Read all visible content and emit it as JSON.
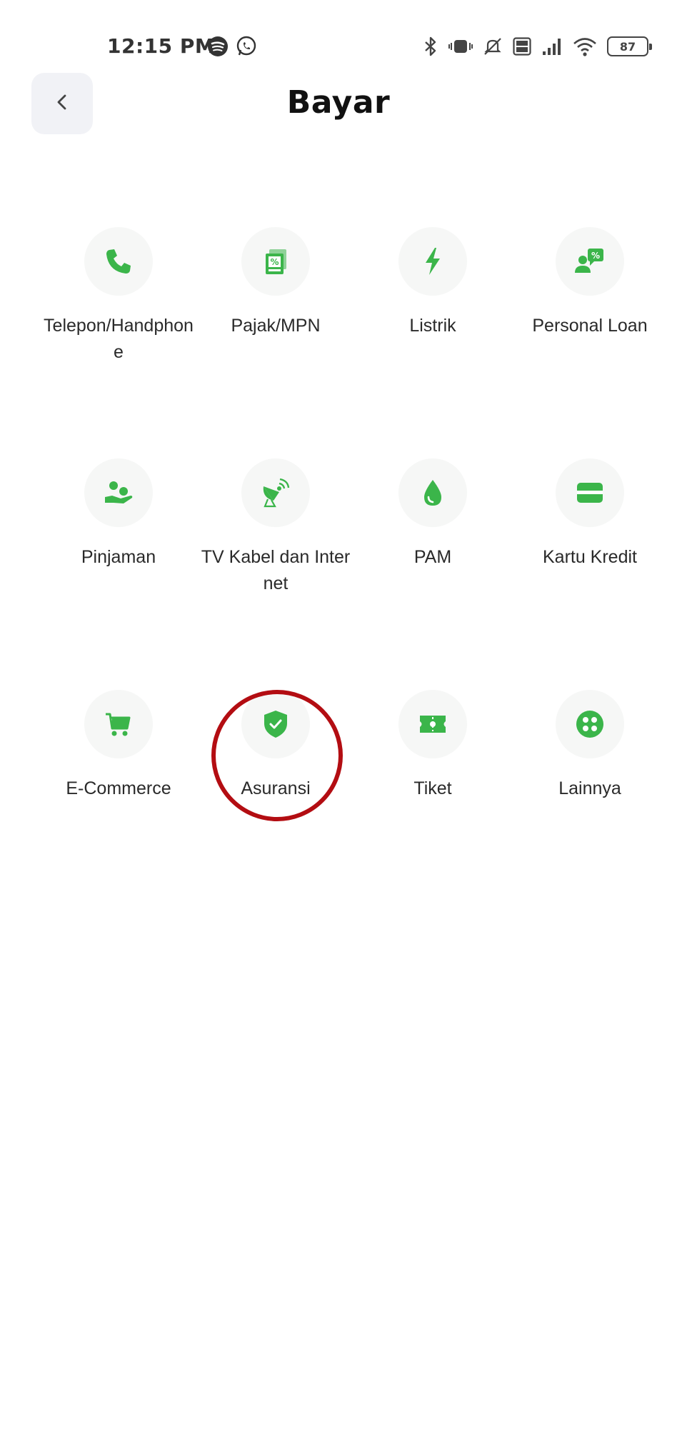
{
  "status_bar": {
    "time": "12:15 PM",
    "battery_level": "87",
    "left_icons": [
      "spotify-icon",
      "whatsapp-icon"
    ],
    "right_icons": [
      "bluetooth-icon",
      "vibrate-icon",
      "mute-icon",
      "volte-icon",
      "signal-icon",
      "wifi-icon",
      "battery-icon"
    ]
  },
  "header": {
    "title": "Bayar",
    "back_icon": "chevron-left-icon"
  },
  "colors": {
    "accent_green": "#3bb54a",
    "highlight_red": "#b30d12",
    "icon_bg": "#f6f7f6"
  },
  "menu": {
    "items": [
      {
        "label": "Telepon/Handphone",
        "icon": "phone-icon"
      },
      {
        "label": "Pajak/MPN",
        "icon": "tax-document-icon"
      },
      {
        "label": "Listrik",
        "icon": "lightning-icon"
      },
      {
        "label": "Personal Loan",
        "icon": "personal-loan-icon"
      },
      {
        "label": "Pinjaman",
        "icon": "loan-hand-icon"
      },
      {
        "label": "TV Kabel dan Internet",
        "icon": "satellite-dish-icon"
      },
      {
        "label": "PAM",
        "icon": "water-drop-icon"
      },
      {
        "label": "Kartu Kredit",
        "icon": "credit-card-icon"
      },
      {
        "label": "E-Commerce",
        "icon": "shopping-cart-icon"
      },
      {
        "label": "Asuransi",
        "icon": "shield-check-icon"
      },
      {
        "label": "Tiket",
        "icon": "ticket-icon"
      },
      {
        "label": "Lainnya",
        "icon": "more-dots-icon"
      }
    ]
  }
}
